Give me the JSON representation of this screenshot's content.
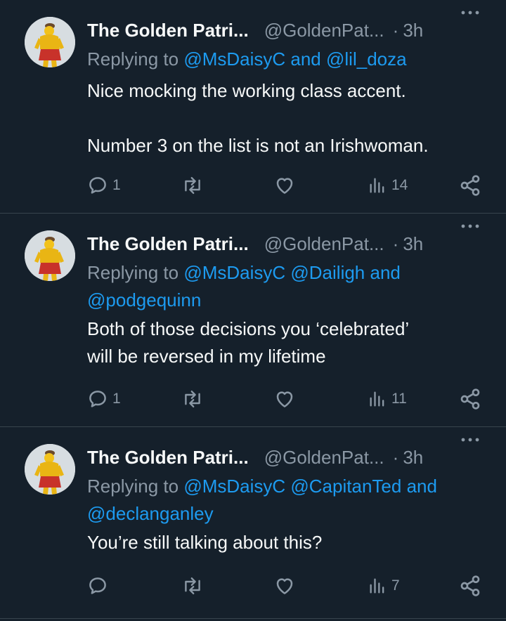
{
  "tweets": [
    {
      "name": "The Golden Patri...",
      "handle": "@GoldenPat...",
      "separator": "·",
      "time": "3h",
      "replying_prefix": "Replying to",
      "replying_line1": [
        {
          "text": "@MsDaisyC",
          "type": "mention"
        },
        {
          "text": "and",
          "type": "mention"
        },
        {
          "text": "@lil_doza",
          "type": "mention"
        }
      ],
      "replying_line2": [],
      "text": "Nice mocking the working class accent.\n\nNumber 3 on the list is not an Irishwoman.",
      "reply_count": "1",
      "repost_count": "",
      "like_count": "",
      "view_count": "14"
    },
    {
      "name": "The Golden Patri...",
      "handle": "@GoldenPat...",
      "separator": "·",
      "time": "3h",
      "replying_prefix": "Replying to",
      "replying_line1": [
        {
          "text": "@MsDaisyC",
          "type": "mention"
        },
        {
          "text": "@Dailigh",
          "type": "mention"
        },
        {
          "text": "and",
          "type": "mention"
        }
      ],
      "replying_line2": [
        {
          "text": "@podgequinn",
          "type": "mention"
        }
      ],
      "text": "Both of those decisions you ‘celebrated’\nwill be reversed in my lifetime",
      "reply_count": "1",
      "repost_count": "",
      "like_count": "",
      "view_count": "11"
    },
    {
      "name": "The Golden Patri...",
      "handle": "@GoldenPat...",
      "separator": "·",
      "time": "3h",
      "replying_prefix": "Replying to",
      "replying_line1": [
        {
          "text": "@MsDaisyC",
          "type": "mention"
        },
        {
          "text": "@CapitanTed",
          "type": "mention"
        },
        {
          "text": "and",
          "type": "mention"
        }
      ],
      "replying_line2": [
        {
          "text": "@declanganley",
          "type": "mention"
        }
      ],
      "text": "You’re still talking about this?",
      "reply_count": "",
      "repost_count": "",
      "like_count": "",
      "view_count": "7"
    }
  ],
  "icons": {
    "reply": "speech-bubble-icon",
    "repost": "repost-arrows-icon",
    "like": "heart-icon",
    "views": "bar-chart-icon",
    "share": "share-nodes-icon",
    "more": "more-dots-icon"
  },
  "colors": {
    "background": "#15202b",
    "text": "#f7f9f9",
    "secondary": "#8b98a5",
    "link": "#1d9bf0",
    "divider": "#38444d"
  }
}
